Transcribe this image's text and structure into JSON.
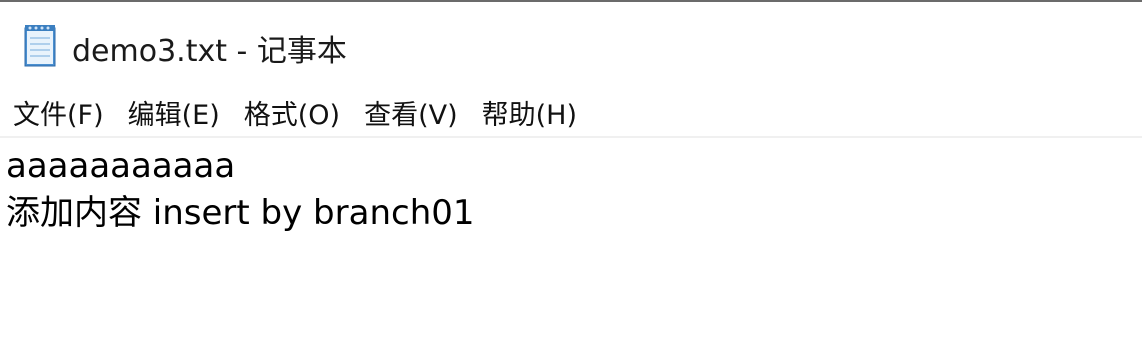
{
  "window": {
    "title": "demo3.txt - 记事本",
    "icon": "notepad-icon"
  },
  "menubar": {
    "items": [
      {
        "label": "文件(F)"
      },
      {
        "label": "编辑(E)"
      },
      {
        "label": "格式(O)"
      },
      {
        "label": "查看(V)"
      },
      {
        "label": "帮助(H)"
      }
    ]
  },
  "editor": {
    "lines": [
      "aaaaaaaaaaa",
      "添加内容 insert by branch01"
    ]
  }
}
